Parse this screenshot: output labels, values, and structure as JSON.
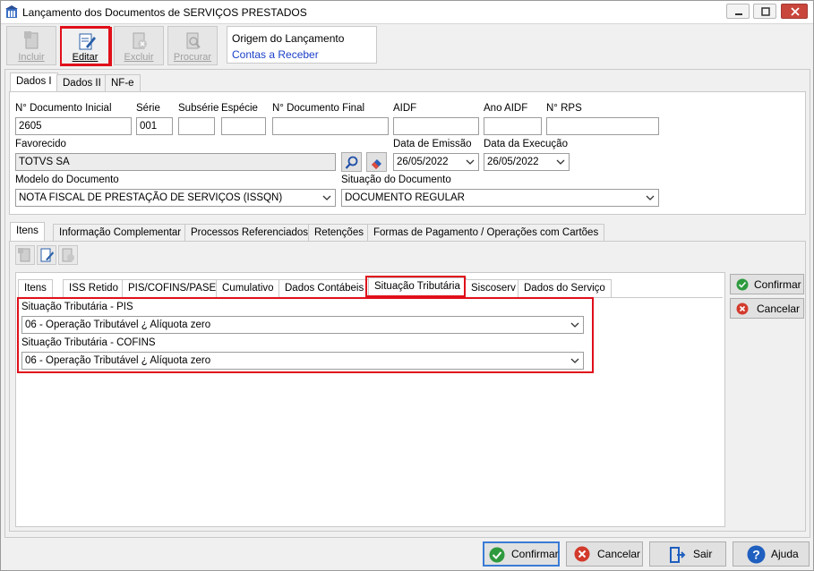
{
  "window": {
    "title": "Lançamento dos Documentos de SERVIÇOS PRESTADOS",
    "icon": "building-icon"
  },
  "toolbar": {
    "incluir": "Incluir",
    "editar": "Editar",
    "excluir": "Excluir",
    "procurar": "Procurar"
  },
  "origem": {
    "label": "Origem do Lançamento",
    "value": "Contas a Receber"
  },
  "top_tabs": [
    "Dados I",
    "Dados II",
    "NF-e"
  ],
  "fields": {
    "doc_inicial_label": "N° Documento Inicial",
    "doc_inicial_value": "2605",
    "serie_label": "Série",
    "serie_value": "001",
    "subserie_label": "Subsérie",
    "especie_label": "Espécie",
    "doc_final_label": "N° Documento Final",
    "aidf_label": "AIDF",
    "ano_aidf_label": "Ano AIDF",
    "rps_label": "N° RPS",
    "favorecido_label": "Favorecido",
    "favorecido_value": "TOTVS SA",
    "data_emissao_label": "Data de Emissão",
    "data_emissao_value": "26/05/2022",
    "data_execucao_label": "Data da Execução",
    "data_execucao_value": "26/05/2022",
    "modelo_label": "Modelo do Documento",
    "modelo_value": "NOTA FISCAL DE PRESTAÇÃO DE SERVIÇOS (ISSQN)",
    "situacao_doc_label": "Situação do Documento",
    "situacao_doc_value": "DOCUMENTO REGULAR"
  },
  "mid_tabs": [
    "Itens",
    "Informação Complementar",
    "Processos Referenciados",
    "Retenções",
    "Formas de Pagamento / Operações com Cartões"
  ],
  "inner_tabs": [
    "Itens",
    "ISS Retido",
    "PIS/COFINS/PASEP",
    "Cumulativo",
    "Dados Contábeis",
    "Situação Tributária",
    "Siscoserv",
    "Dados do Serviço"
  ],
  "situacao": {
    "pis_label": "Situação Tributária - PIS",
    "pis_value": "06 - Operação Tributável ¿ Alíquota zero",
    "cofins_label": "Situação Tributária - COFINS",
    "cofins_value": "06 - Operação Tributável ¿ Alíquota zero"
  },
  "side_buttons": {
    "confirmar": "Confirmar",
    "cancelar": "Cancelar"
  },
  "bottom_buttons": {
    "confirmar": "Confirmar",
    "cancelar": "Cancelar",
    "sair": "Sair",
    "ajuda": "Ajuda"
  },
  "colors": {
    "highlight": "#e0101a",
    "link": "#1a3fc8",
    "confirm_green": "#2e9a3e",
    "cancel_red": "#d23a2c",
    "help_blue": "#1f5fbf"
  }
}
